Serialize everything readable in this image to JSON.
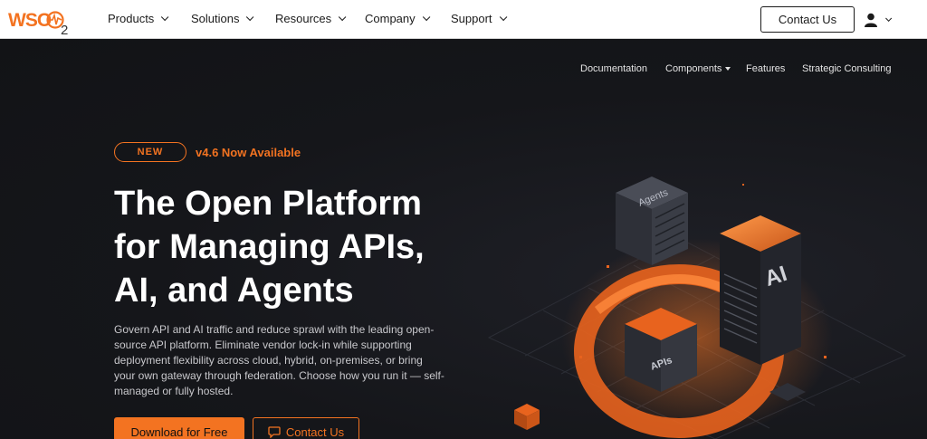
{
  "header": {
    "logo_text": "WSO2",
    "nav": [
      {
        "label": "Products"
      },
      {
        "label": "Solutions"
      },
      {
        "label": "Resources"
      },
      {
        "label": "Company"
      },
      {
        "label": "Support"
      }
    ],
    "contact_label": "Contact Us"
  },
  "subnav": {
    "items": [
      {
        "label": "Documentation"
      },
      {
        "label": "Components"
      },
      {
        "label": "Features"
      },
      {
        "label": "Strategic Consulting"
      }
    ]
  },
  "hero": {
    "badge": "NEW",
    "version": "v4.6 Now Available",
    "headline_lines": [
      "The Open Platform",
      "for Managing APIs,",
      "AI, and Agents"
    ],
    "description": "Govern API and AI traffic and reduce sprawl with the leading open-source API platform. Eliminate vendor lock-in while supporting deployment flexibility across cloud, hybrid, on-premises, or bring your own gateway through federation. Choose how you run it — self-managed or fully hosted.",
    "download_label": "Download for Free",
    "contact_label": "Contact Us",
    "art_labels": {
      "agents": "Agents",
      "ai": "AI",
      "apis": "APIs"
    }
  },
  "colors": {
    "accent": "#f37321",
    "background": "#141416",
    "header_bg": "#ffffff"
  },
  "icons": {
    "user": "user-icon",
    "chevron": "chevron-down-icon",
    "chat": "chat-icon"
  }
}
